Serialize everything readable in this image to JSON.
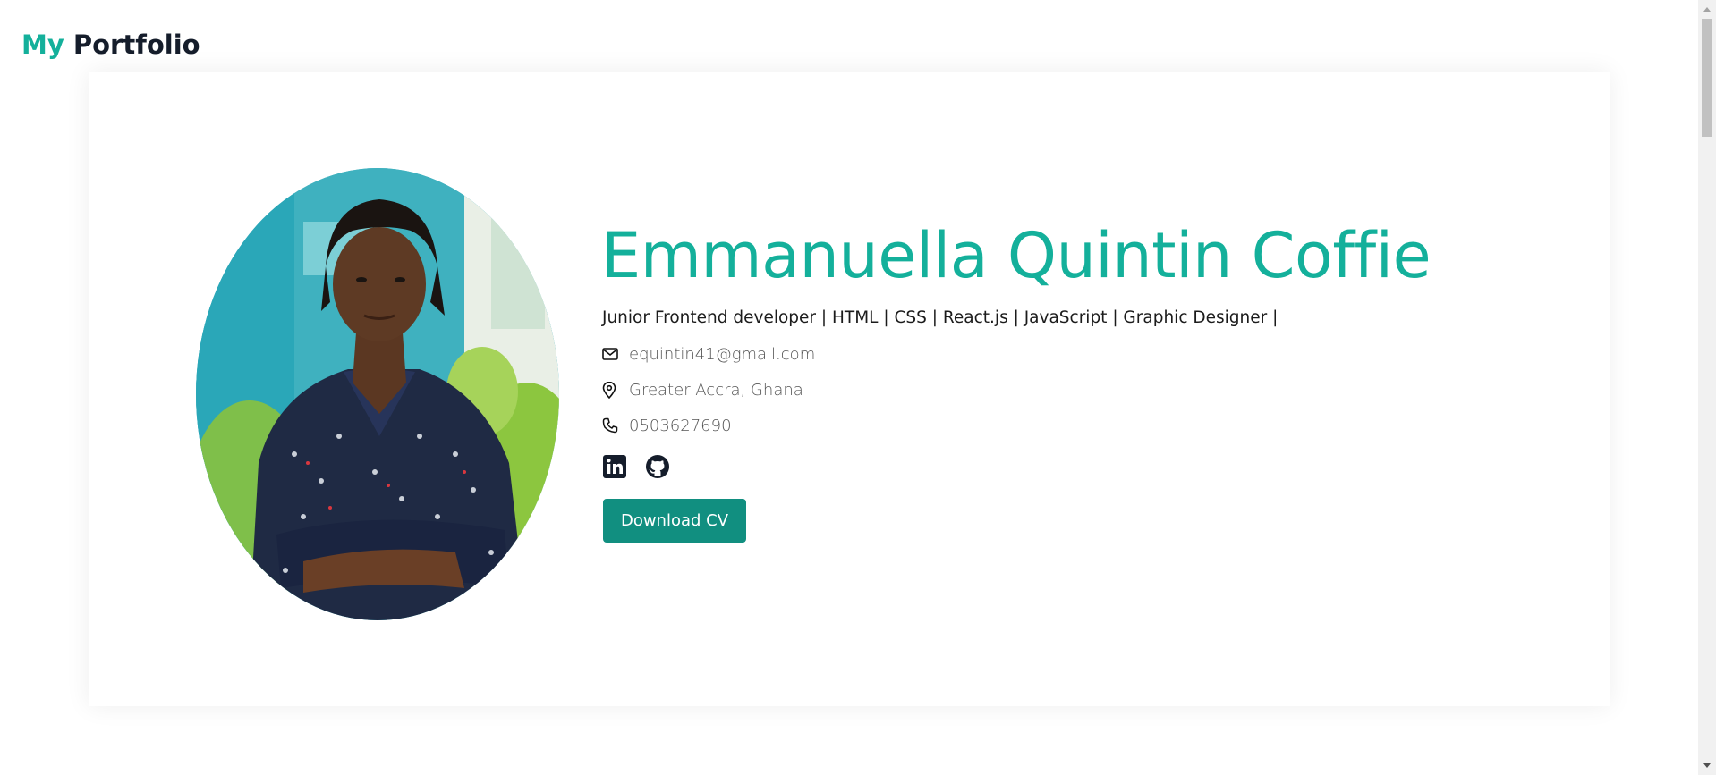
{
  "brand": {
    "accent": "My",
    "main": "Portfolio"
  },
  "profile": {
    "name": "Emmanuella Quintin Coffie",
    "tagline": "Junior Frontend developer | HTML | CSS | React.js | JavaScript | Graphic Designer |",
    "email": "equintin41@gmail.com",
    "location": "Greater Accra, Ghana",
    "phone": "0503627690"
  },
  "socials": [
    {
      "icon": "linkedin-icon"
    },
    {
      "icon": "github-icon"
    }
  ],
  "cta": {
    "download_label": "Download CV"
  },
  "colors": {
    "accent": "#14b09b",
    "button": "#118f80",
    "text": "#151d2b"
  }
}
